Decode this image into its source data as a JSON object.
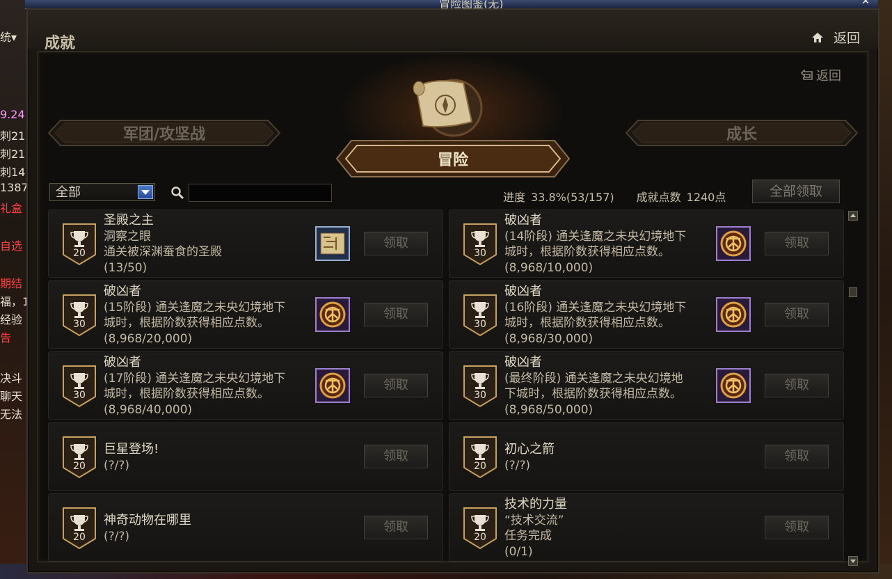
{
  "window_title": "冒险图鉴(无)",
  "left_hud": [
    "统▾",
    "9.24",
    "刺21",
    "刺21",
    "刺14",
    "1387",
    "礼盒",
    "自选",
    "期结",
    "福，1",
    "经验",
    "告",
    "决斗",
    "聊天",
    "无法"
  ],
  "header": {
    "title": "成就",
    "back_label": "返回"
  },
  "panel": {
    "back_label": "返回"
  },
  "categories": {
    "left": "军团/攻坚战",
    "center": "冒险",
    "right": "成长"
  },
  "filter": {
    "selected": "全部"
  },
  "search": {
    "placeholder": ""
  },
  "progress": {
    "label": "进度",
    "value": "33.8%(53/157)",
    "points_label": "成就点数",
    "points_value": "1240点"
  },
  "claim_all_label": "全部领取",
  "achievements": [
    {
      "title": "圣殿之主",
      "lines": [
        "洞察之眼",
        "通关被深渊蚕食的圣殿",
        "(13/50)"
      ],
      "points": "20",
      "reward": "map-icon",
      "claim": "领取"
    },
    {
      "title": "破凶者",
      "lines": [
        "(14阶段) 通关逢魔之未央幻境地下",
        "城时，根据阶数获得相应点数。",
        "(8,968/10,000)"
      ],
      "points": "30",
      "reward": "emblem-icon",
      "claim": "领取"
    },
    {
      "title": "破凶者",
      "lines": [
        "(15阶段) 通关逢魔之未央幻境地下",
        "城时，根据阶数获得相应点数。",
        "(8,968/20,000)"
      ],
      "points": "30",
      "reward": "emblem-icon",
      "claim": "领取"
    },
    {
      "title": "破凶者",
      "lines": [
        "(16阶段) 通关逢魔之未央幻境地下",
        "城时，根据阶数获得相应点数。",
        "(8,968/30,000)"
      ],
      "points": "30",
      "reward": "emblem-icon",
      "claim": "领取"
    },
    {
      "title": "破凶者",
      "lines": [
        "(17阶段) 通关逢魔之未央幻境地下",
        "城时，根据阶数获得相应点数。",
        "(8,968/40,000)"
      ],
      "points": "30",
      "reward": "emblem-icon",
      "claim": "领取"
    },
    {
      "title": "破凶者",
      "lines": [
        "(最终阶段) 通关逢魔之未央幻境地",
        "下城时，根据阶数获得相应点数。",
        "(8,968/50,000)"
      ],
      "points": "30",
      "reward": "emblem-icon",
      "claim": "领取"
    },
    {
      "title": "巨星登场!",
      "lines": [
        "(?/?)"
      ],
      "points": "20",
      "reward": "",
      "claim": "领取"
    },
    {
      "title": "初心之箭",
      "lines": [
        "(?/?)"
      ],
      "points": "20",
      "reward": "",
      "claim": "领取"
    },
    {
      "title": "神奇动物在哪里",
      "lines": [
        "(?/?)"
      ],
      "points": "20",
      "reward": "",
      "claim": "领取"
    },
    {
      "title": "技术的力量",
      "lines": [
        "“技术交流”",
        "任务完成",
        "(0/1)"
      ],
      "points": "20",
      "reward": "",
      "claim": "领取"
    }
  ],
  "colors": {
    "accent_gold": "#c8a060",
    "panel_bg": "#0f0e0c",
    "text": "#c8bfa8"
  }
}
